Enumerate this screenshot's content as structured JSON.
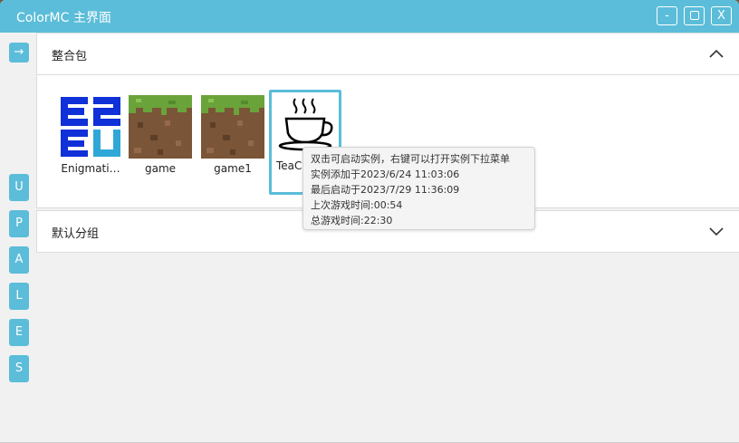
{
  "window": {
    "title": "ColorMC 主界面",
    "minimize_label": "-",
    "close_label": "X",
    "accent_color": "#5bbdd9"
  },
  "sidebar": {
    "arrow_label": "→",
    "letters": [
      "U",
      "P",
      "A",
      "L",
      "E",
      "S"
    ]
  },
  "groups": [
    {
      "title": "整合包",
      "expanded": true,
      "chevron": "chevron-up-icon",
      "items": [
        {
          "label": "Enigmati…",
          "icon": "e2e-logo-icon"
        },
        {
          "label": "game",
          "icon": "grass-block-icon"
        },
        {
          "label": "game1",
          "icon": "grass-block-icon"
        },
        {
          "label": "TeaC",
          "icon": "tea-cup-icon",
          "selected": true
        }
      ]
    },
    {
      "title": "默认分组",
      "expanded": false,
      "chevron": "chevron-down-icon"
    }
  ],
  "tooltip": {
    "hint": "双击可启动实例，右键可以打开实例下拉菜单",
    "added": "实例添加于2023/6/24 11:03:06",
    "last_launch": "最后启动于2023/7/29 11:36:09",
    "last_play": "上次游戏时间:00:54",
    "total_play": "总游戏时间:22:30"
  }
}
